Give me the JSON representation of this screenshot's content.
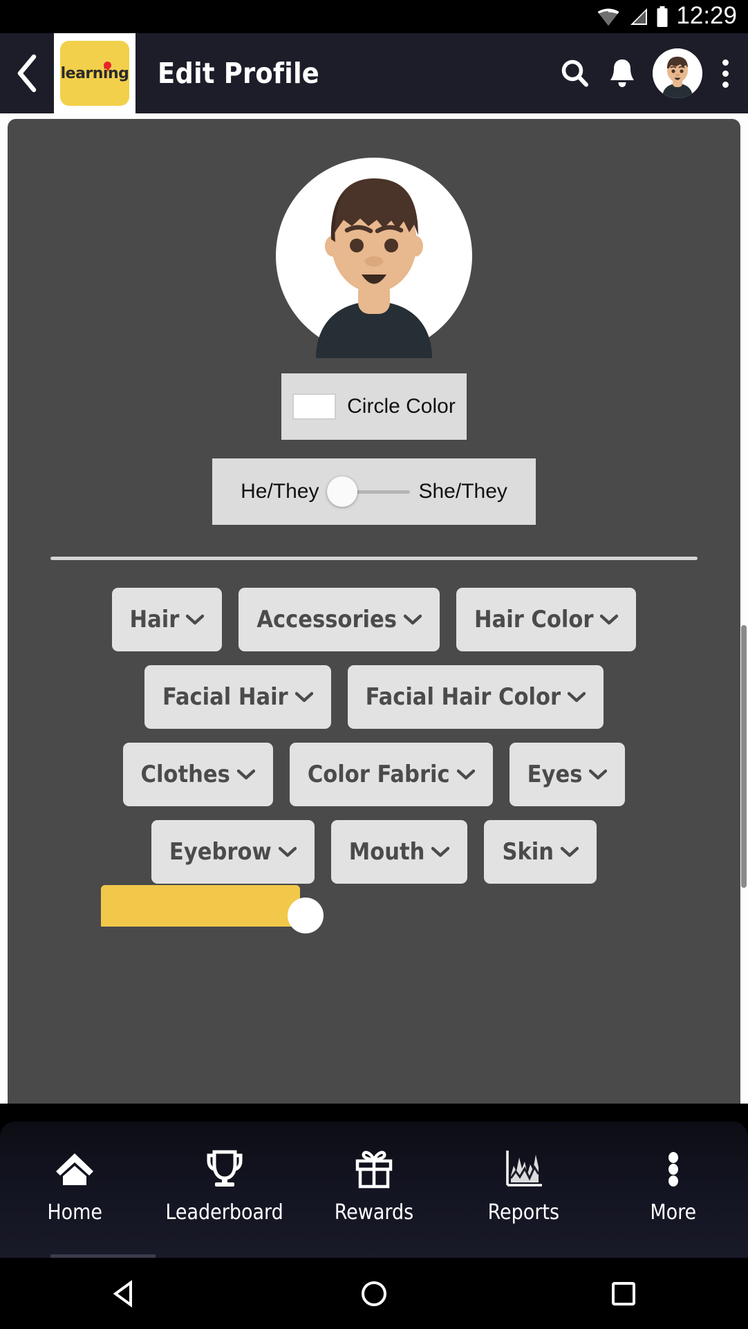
{
  "status_bar": {
    "time": "12:29",
    "icons": [
      "wifi-icon",
      "signal-icon",
      "battery-icon"
    ]
  },
  "header": {
    "back_icon": "chevron-left-icon",
    "logo_text": "learning",
    "title": "Edit Profile",
    "search_icon": "search-icon",
    "notifications_icon": "bell-icon",
    "avatar_icon": "user-avatar",
    "overflow_icon": "kebab-menu-icon"
  },
  "profile": {
    "avatar_alt": "avatar-illustration",
    "circle_color": {
      "label": "Circle Color",
      "swatch_hex": "#ffffff"
    },
    "pronoun_slider": {
      "left_label": "He/They",
      "right_label": "She/They",
      "value": 0
    },
    "option_rows": [
      [
        {
          "label": "Hair",
          "name": "hair"
        },
        {
          "label": "Accessories",
          "name": "accessories"
        },
        {
          "label": "Hair Color",
          "name": "hair-color"
        }
      ],
      [
        {
          "label": "Facial Hair",
          "name": "facial-hair"
        },
        {
          "label": "Facial Hair Color",
          "name": "facial-hair-color"
        }
      ],
      [
        {
          "label": "Clothes",
          "name": "clothes"
        },
        {
          "label": "Color Fabric",
          "name": "color-fabric"
        },
        {
          "label": "Eyes",
          "name": "eyes"
        }
      ],
      [
        {
          "label": "Eyebrow",
          "name": "eyebrow"
        },
        {
          "label": "Mouth",
          "name": "mouth"
        },
        {
          "label": "Skin",
          "name": "skin"
        }
      ]
    ]
  },
  "bottom_nav": {
    "items": [
      {
        "label": "Home",
        "icon": "home-icon"
      },
      {
        "label": "Leaderboard",
        "icon": "trophy-icon"
      },
      {
        "label": "Rewards",
        "icon": "gift-icon"
      },
      {
        "label": "Reports",
        "icon": "chart-icon"
      },
      {
        "label": "More",
        "icon": "kebab-menu-icon"
      }
    ]
  },
  "android_nav": {
    "back": "back-triangle-icon",
    "home": "home-circle-icon",
    "recents": "recents-square-icon"
  },
  "colors": {
    "brand_yellow": "#f2d04b",
    "header_bg": "#1c1d29",
    "card_bg": "#4a4a4a",
    "control_bg": "#dcdcdc",
    "dropdown_bg": "#e2e2e2",
    "skin": "#e8b88e",
    "hair": "#4a3328",
    "shirt": "#262f35"
  }
}
